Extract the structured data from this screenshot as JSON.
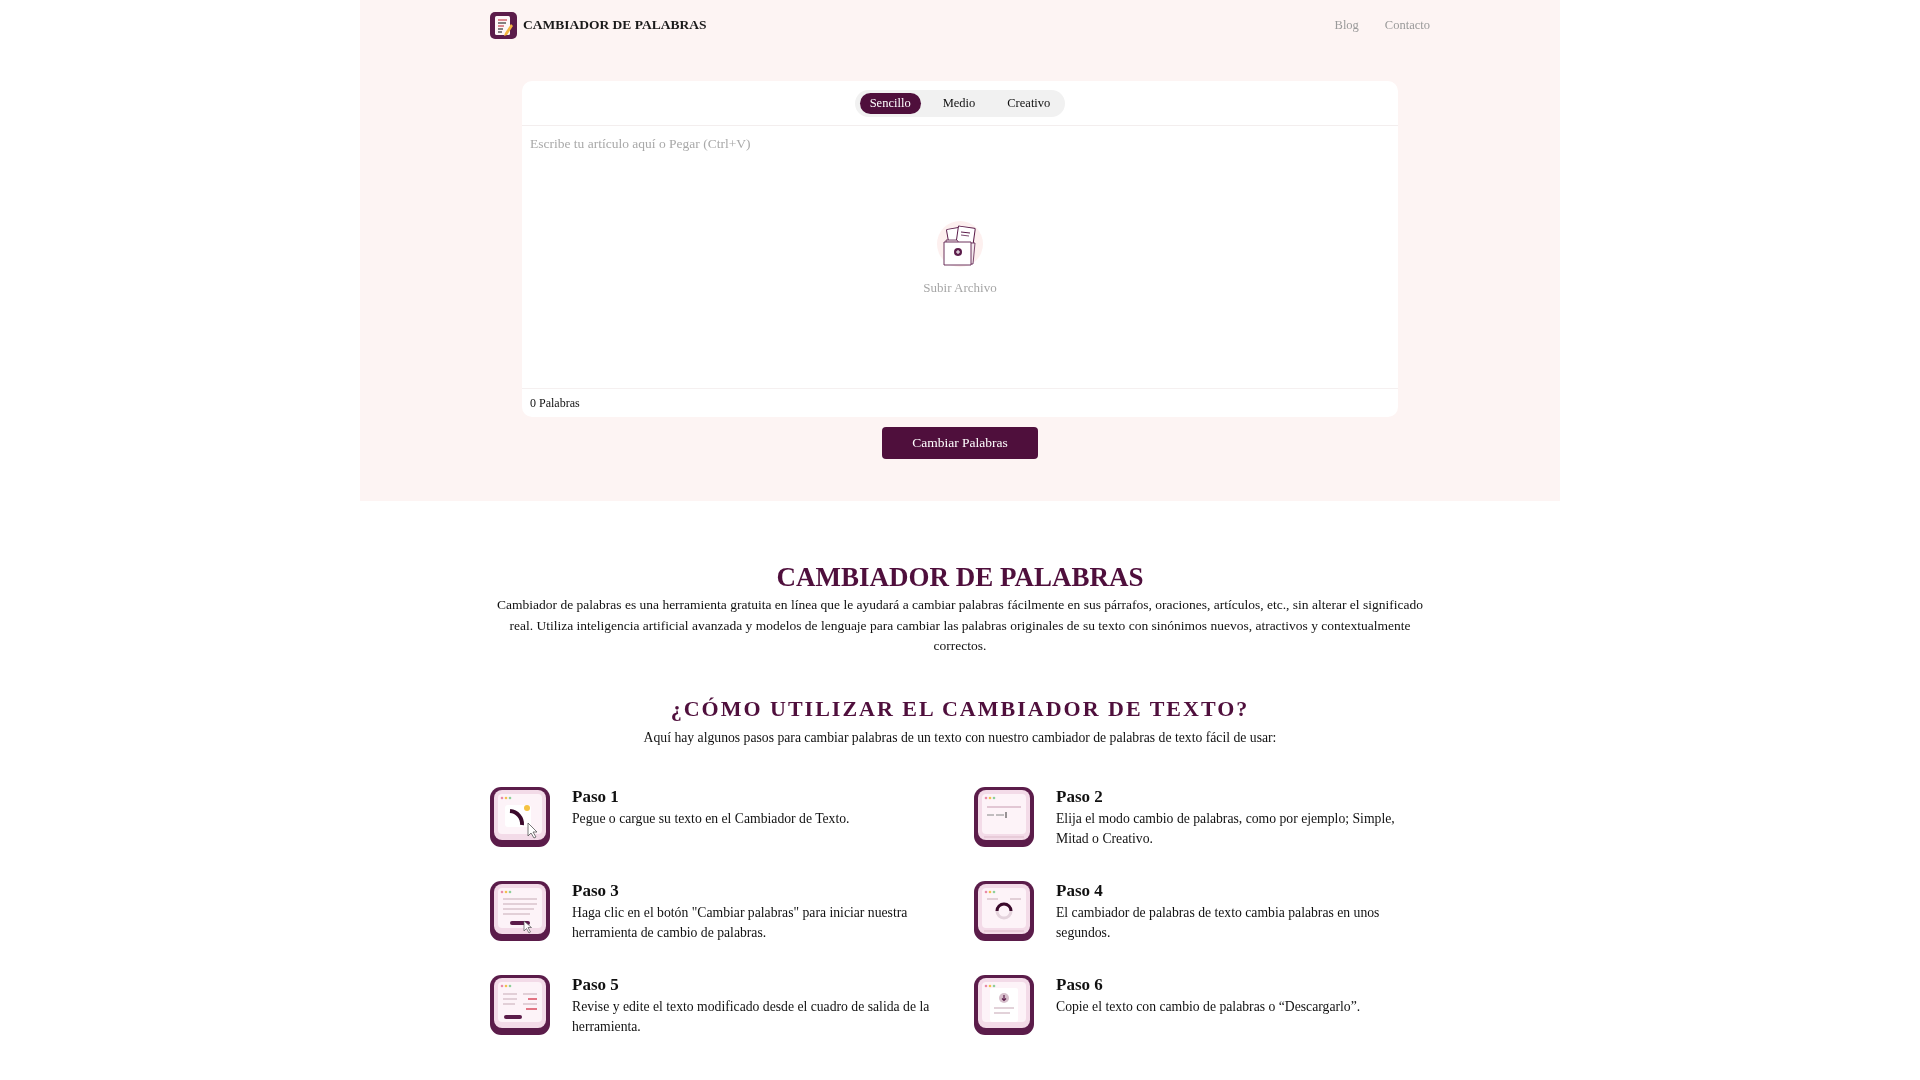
{
  "header": {
    "brand": "CAMBIADOR DE PALABRAS",
    "nav": [
      "Blog",
      "Contacto"
    ]
  },
  "editor": {
    "modes": [
      {
        "label": "Sencillo",
        "selected": true
      },
      {
        "label": "Medio",
        "selected": false
      },
      {
        "label": "Creativo",
        "selected": false
      }
    ],
    "placeholder": "Escribe tu artículo aquí o Pegar (Ctrl+V)",
    "upload_label": "Subir Archivo",
    "word_count": "0 Palabras"
  },
  "submit_button": "Cambiar Palabras",
  "intro": {
    "title": "CAMBIADOR DE PALABRAS",
    "text": "Cambiador de palabras es una herramienta gratuita en línea que le ayudará a cambiar palabras fácilmente en sus párrafos, oraciones, artículos, etc., sin alterar el significado real. Utiliza inteligencia artificial avanzada y modelos de lenguaje para cambiar las palabras originales de su texto con sinónimos nuevos, atractivos y contextualmente correctos."
  },
  "how_to": {
    "title": "¿CÓMO UTILIZAR EL CAMBIADOR DE TEXTO?",
    "subtitle": "Aquí hay algunos pasos para cambiar palabras de un texto con nuestro cambiador de palabras de texto fácil de usar:",
    "steps": [
      {
        "title": "Paso 1",
        "text": "Pegue o cargue su texto en el Cambiador de Texto."
      },
      {
        "title": "Paso 2",
        "text": "Elija el modo cambio de palabras, como por ejemplo; Simple, Mitad o Creativo."
      },
      {
        "title": "Paso 3",
        "text": "Haga clic en el botón \"Cambiar palabras\" para iniciar nuestra herramienta de cambio de palabras."
      },
      {
        "title": "Paso 4",
        "text": "El cambiador de palabras de texto cambia palabras en unos segundos."
      },
      {
        "title": "Paso 5",
        "text": "Revise y edite el texto modificado desde el cuadro de salida de la herramienta."
      },
      {
        "title": "Paso 6",
        "text": "Copie el texto con cambio de palabras o “Descargarlo”."
      }
    ]
  }
}
